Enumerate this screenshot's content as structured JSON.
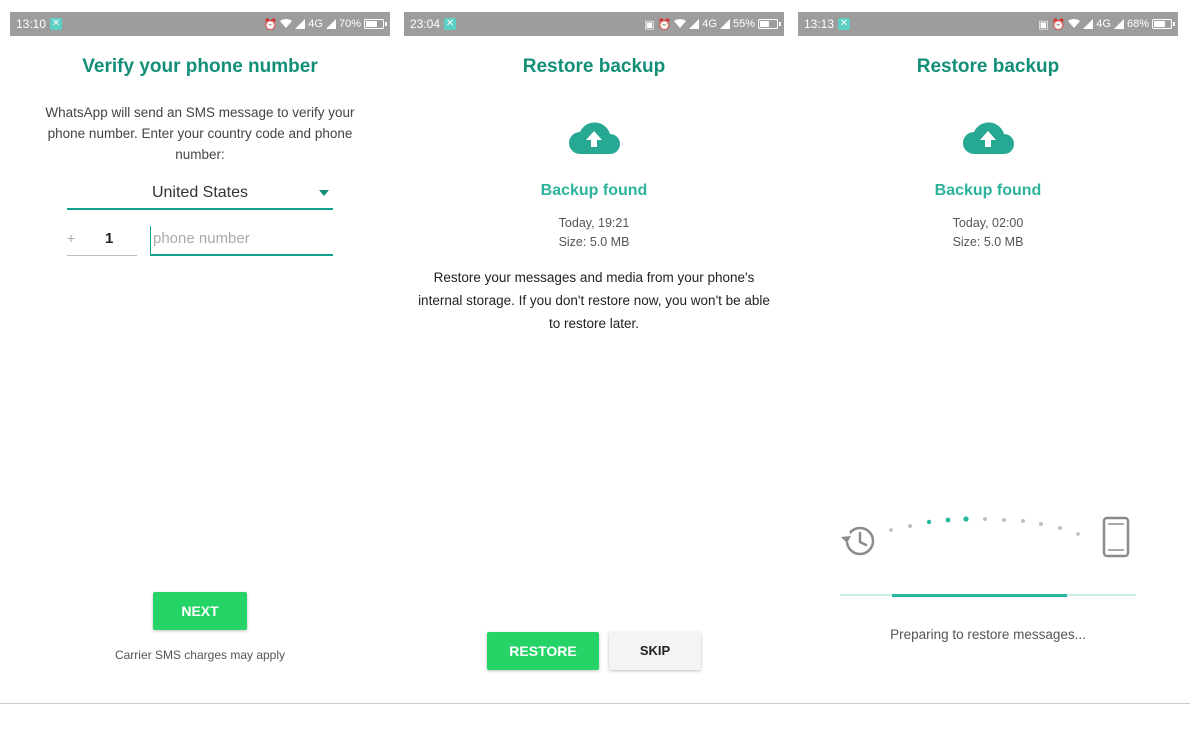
{
  "colors": {
    "accent": "#138f78",
    "button_green": "#26d367",
    "status_bar": "#9d9d9d",
    "notif": "#5ad1c4"
  },
  "screens": [
    {
      "status": {
        "time": "13:10",
        "battery": "70%",
        "network": "4G",
        "battery_level": 0.7
      },
      "title": "Verify your phone number",
      "description": "WhatsApp will send an SMS message to verify your phone number. Enter your country code and phone number:",
      "country": "United States",
      "country_code_prefix": "+",
      "country_code": "1",
      "phone_placeholder": "phone number",
      "next_label": "NEXT",
      "carrier_note": "Carrier SMS charges may apply"
    },
    {
      "status": {
        "time": "23:04",
        "battery": "55%",
        "network": "4G",
        "battery_level": 0.55
      },
      "title": "Restore backup",
      "found_label": "Backup found",
      "backup_time": "Today, 19:21",
      "backup_size": "Size: 5.0 MB",
      "description": "Restore your messages and media from your phone's internal storage. If you don't restore now, you won't be able to restore later.",
      "restore_label": "RESTORE",
      "skip_label": "SKIP"
    },
    {
      "status": {
        "time": "13:13",
        "battery": "68%",
        "network": "4G",
        "battery_level": 0.68
      },
      "title": "Restore backup",
      "found_label": "Backup found",
      "backup_time": "Today, 02:00",
      "backup_size": "Size: 5.0 MB",
      "progress": 0.59,
      "preparing_text": "Preparing to restore messages..."
    }
  ]
}
